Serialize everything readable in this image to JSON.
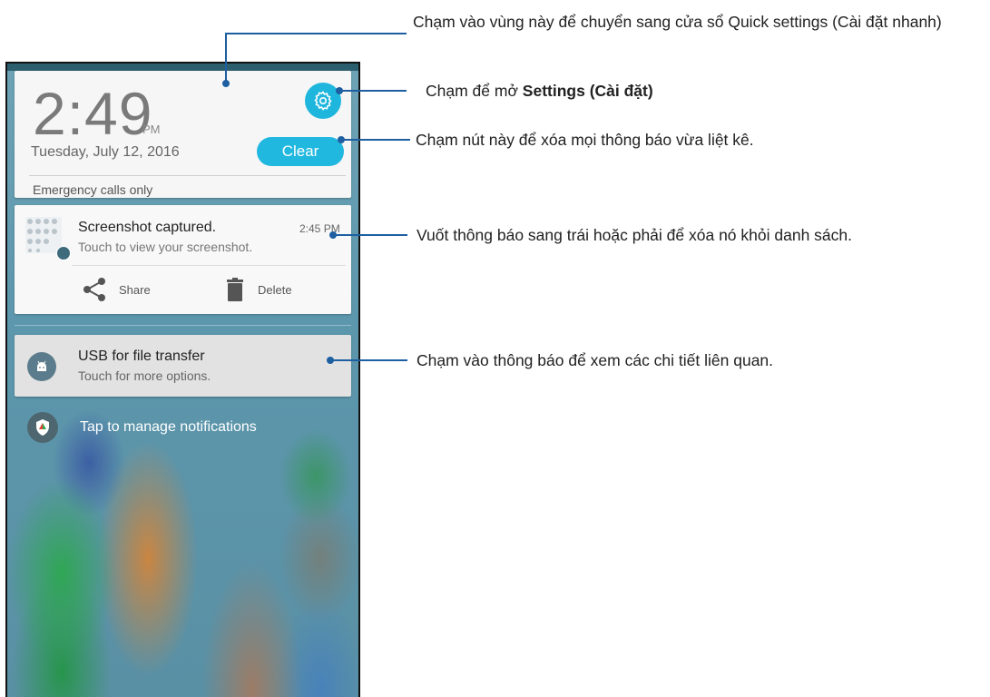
{
  "phone": {
    "time": "2:49",
    "ampm": "PM",
    "date": "Tuesday, July 12, 2016",
    "clear_label": "Clear",
    "emergency": "Emergency calls only",
    "notifications": [
      {
        "title": "Screenshot captured.",
        "time": "2:45 PM",
        "subtitle": "Touch to view your screenshot.",
        "actions": [
          {
            "label": "Share",
            "icon": "share-icon"
          },
          {
            "label": "Delete",
            "icon": "trash-icon"
          }
        ]
      },
      {
        "title": "USB for file transfer",
        "subtitle": "Touch for more options.",
        "icon": "android-icon"
      }
    ],
    "manage": "Tap to manage notifications"
  },
  "callouts": {
    "quick_settings": "Chạm vào vùng này để chuyển sang cửa sổ Quick settings (Cài đặt nhanh)",
    "settings_prefix": "Chạm để mở ",
    "settings_bold": "Settings (Cài đặt)",
    "clear": "Chạm nút này để xóa mọi thông báo vừa liệt kê.",
    "swipe": "Vuốt thông báo sang trái hoặc phải để xóa nó khỏi danh sách.",
    "details": "Chạm vào thông báo để xem các chi tiết liên quan."
  },
  "colors": {
    "accent": "#1fb6dd",
    "callout_line": "#1d5fa1"
  }
}
